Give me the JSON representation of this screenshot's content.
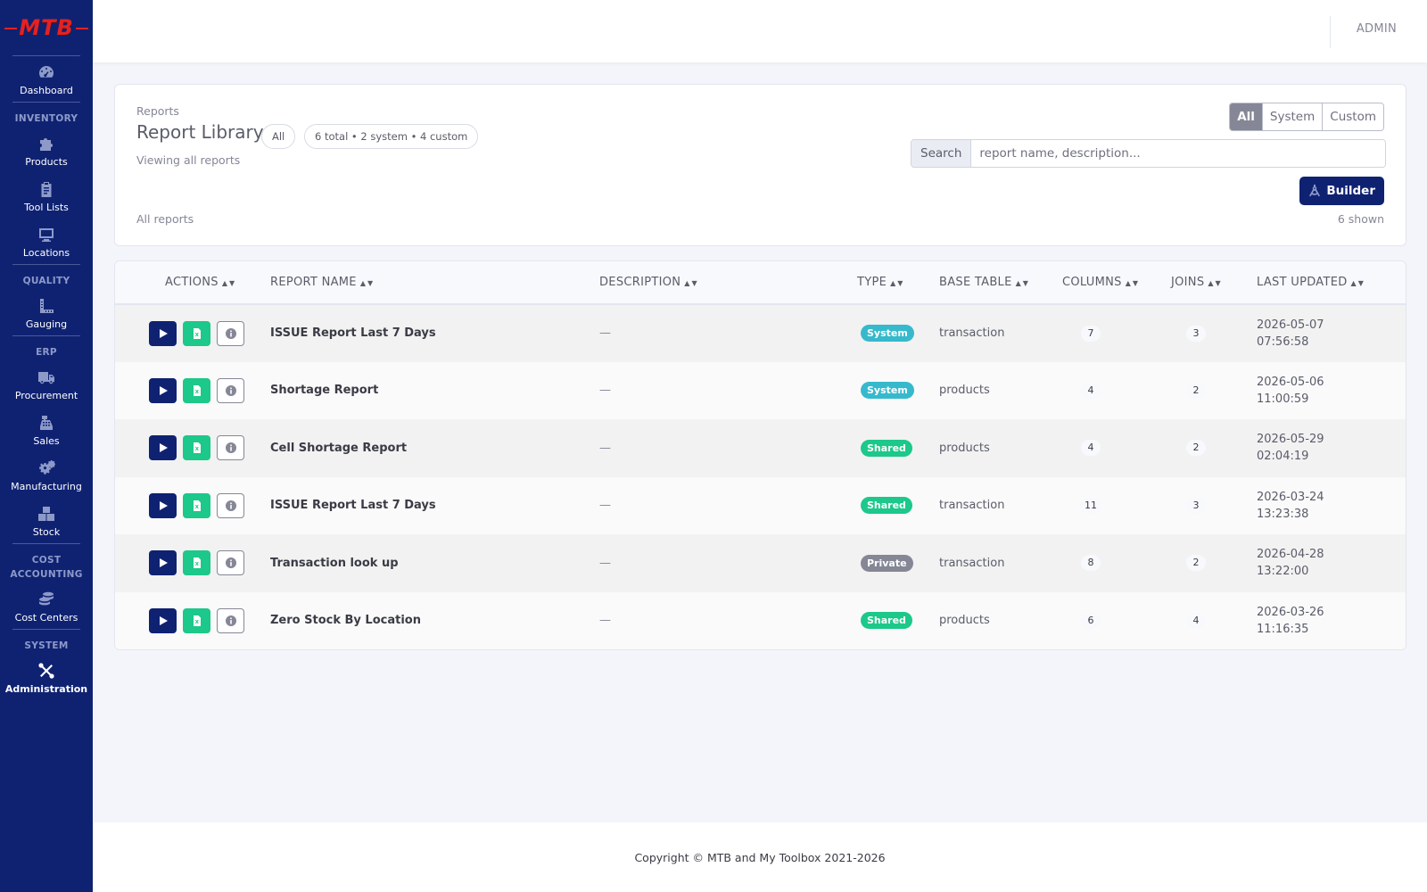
{
  "app": {
    "logo": "MTB",
    "user": "ADMIN"
  },
  "sidebar": {
    "dashboard": {
      "label": "Dashboard",
      "icon": "dashboard-icon"
    },
    "sections": [
      {
        "title": "INVENTORY",
        "items": [
          {
            "label": "Products",
            "icon": "puzzle-icon"
          },
          {
            "label": "Tool Lists",
            "icon": "clipboard-icon"
          },
          {
            "label": "Locations",
            "icon": "monitor-icon"
          }
        ]
      },
      {
        "title": "QUALITY",
        "items": [
          {
            "label": "Gauging",
            "icon": "ruler-icon"
          }
        ]
      },
      {
        "title": "ERP",
        "items": [
          {
            "label": "Procurement",
            "icon": "truck-icon"
          },
          {
            "label": "Sales",
            "icon": "cash-register-icon"
          },
          {
            "label": "Manufacturing",
            "icon": "cogs-icon"
          },
          {
            "label": "Stock",
            "icon": "boxes-icon"
          }
        ]
      },
      {
        "title": "COST ACCOUNTING",
        "items": [
          {
            "label": "Cost Centers",
            "icon": "coins-icon"
          }
        ]
      },
      {
        "title": "SYSTEM",
        "items": [
          {
            "label": "Administration",
            "icon": "tools-icon",
            "active": true
          }
        ]
      }
    ]
  },
  "header": {
    "breadcrumb": "Reports",
    "title": "Report Library",
    "filter_pill": "All",
    "summary_pill": "6 total • 2 system • 4 custom",
    "viewing": "Viewing all reports",
    "list_label": "All reports",
    "shown": "6 shown",
    "segments": [
      {
        "label": "All",
        "active": true
      },
      {
        "label": "System",
        "active": false
      },
      {
        "label": "Custom",
        "active": false
      }
    ],
    "search": {
      "label": "Search",
      "placeholder": "report name, description..."
    },
    "builder_label": "Builder"
  },
  "table": {
    "columns": [
      "ACTIONS",
      "REPORT NAME",
      "DESCRIPTION",
      "TYPE",
      "BASE TABLE",
      "COLUMNS",
      "JOINS",
      "LAST UPDATED"
    ],
    "rows": [
      {
        "name": "ISSUE Report Last 7 Days",
        "description": "—",
        "type": "System",
        "base_table": "transaction",
        "columns": "7",
        "joins": "3",
        "date": "2026-05-07",
        "time": "07:56:58"
      },
      {
        "name": "Shortage Report",
        "description": "—",
        "type": "System",
        "base_table": "products",
        "columns": "4",
        "joins": "2",
        "date": "2026-05-06",
        "time": "11:00:59"
      },
      {
        "name": "Cell Shortage Report",
        "description": "—",
        "type": "Shared",
        "base_table": "products",
        "columns": "4",
        "joins": "2",
        "date": "2026-05-29",
        "time": "02:04:19"
      },
      {
        "name": "ISSUE Report Last 7 Days",
        "description": "—",
        "type": "Shared",
        "base_table": "transaction",
        "columns": "11",
        "joins": "3",
        "date": "2026-03-24",
        "time": "13:23:38"
      },
      {
        "name": "Transaction look up",
        "description": "—",
        "type": "Private",
        "base_table": "transaction",
        "columns": "8",
        "joins": "2",
        "date": "2026-04-28",
        "time": "13:22:00"
      },
      {
        "name": "Zero Stock By Location",
        "description": "—",
        "type": "Shared",
        "base_table": "products",
        "columns": "6",
        "joins": "4",
        "date": "2026-03-26",
        "time": "11:16:35"
      }
    ]
  },
  "colors": {
    "primary": "#0f2272",
    "success": "#1cc88a",
    "info": "#36b9cc",
    "secondary": "#858796",
    "logo": "#e32222"
  },
  "footer": {
    "copyright": "Copyright © MTB and My Toolbox 2021-2026"
  }
}
